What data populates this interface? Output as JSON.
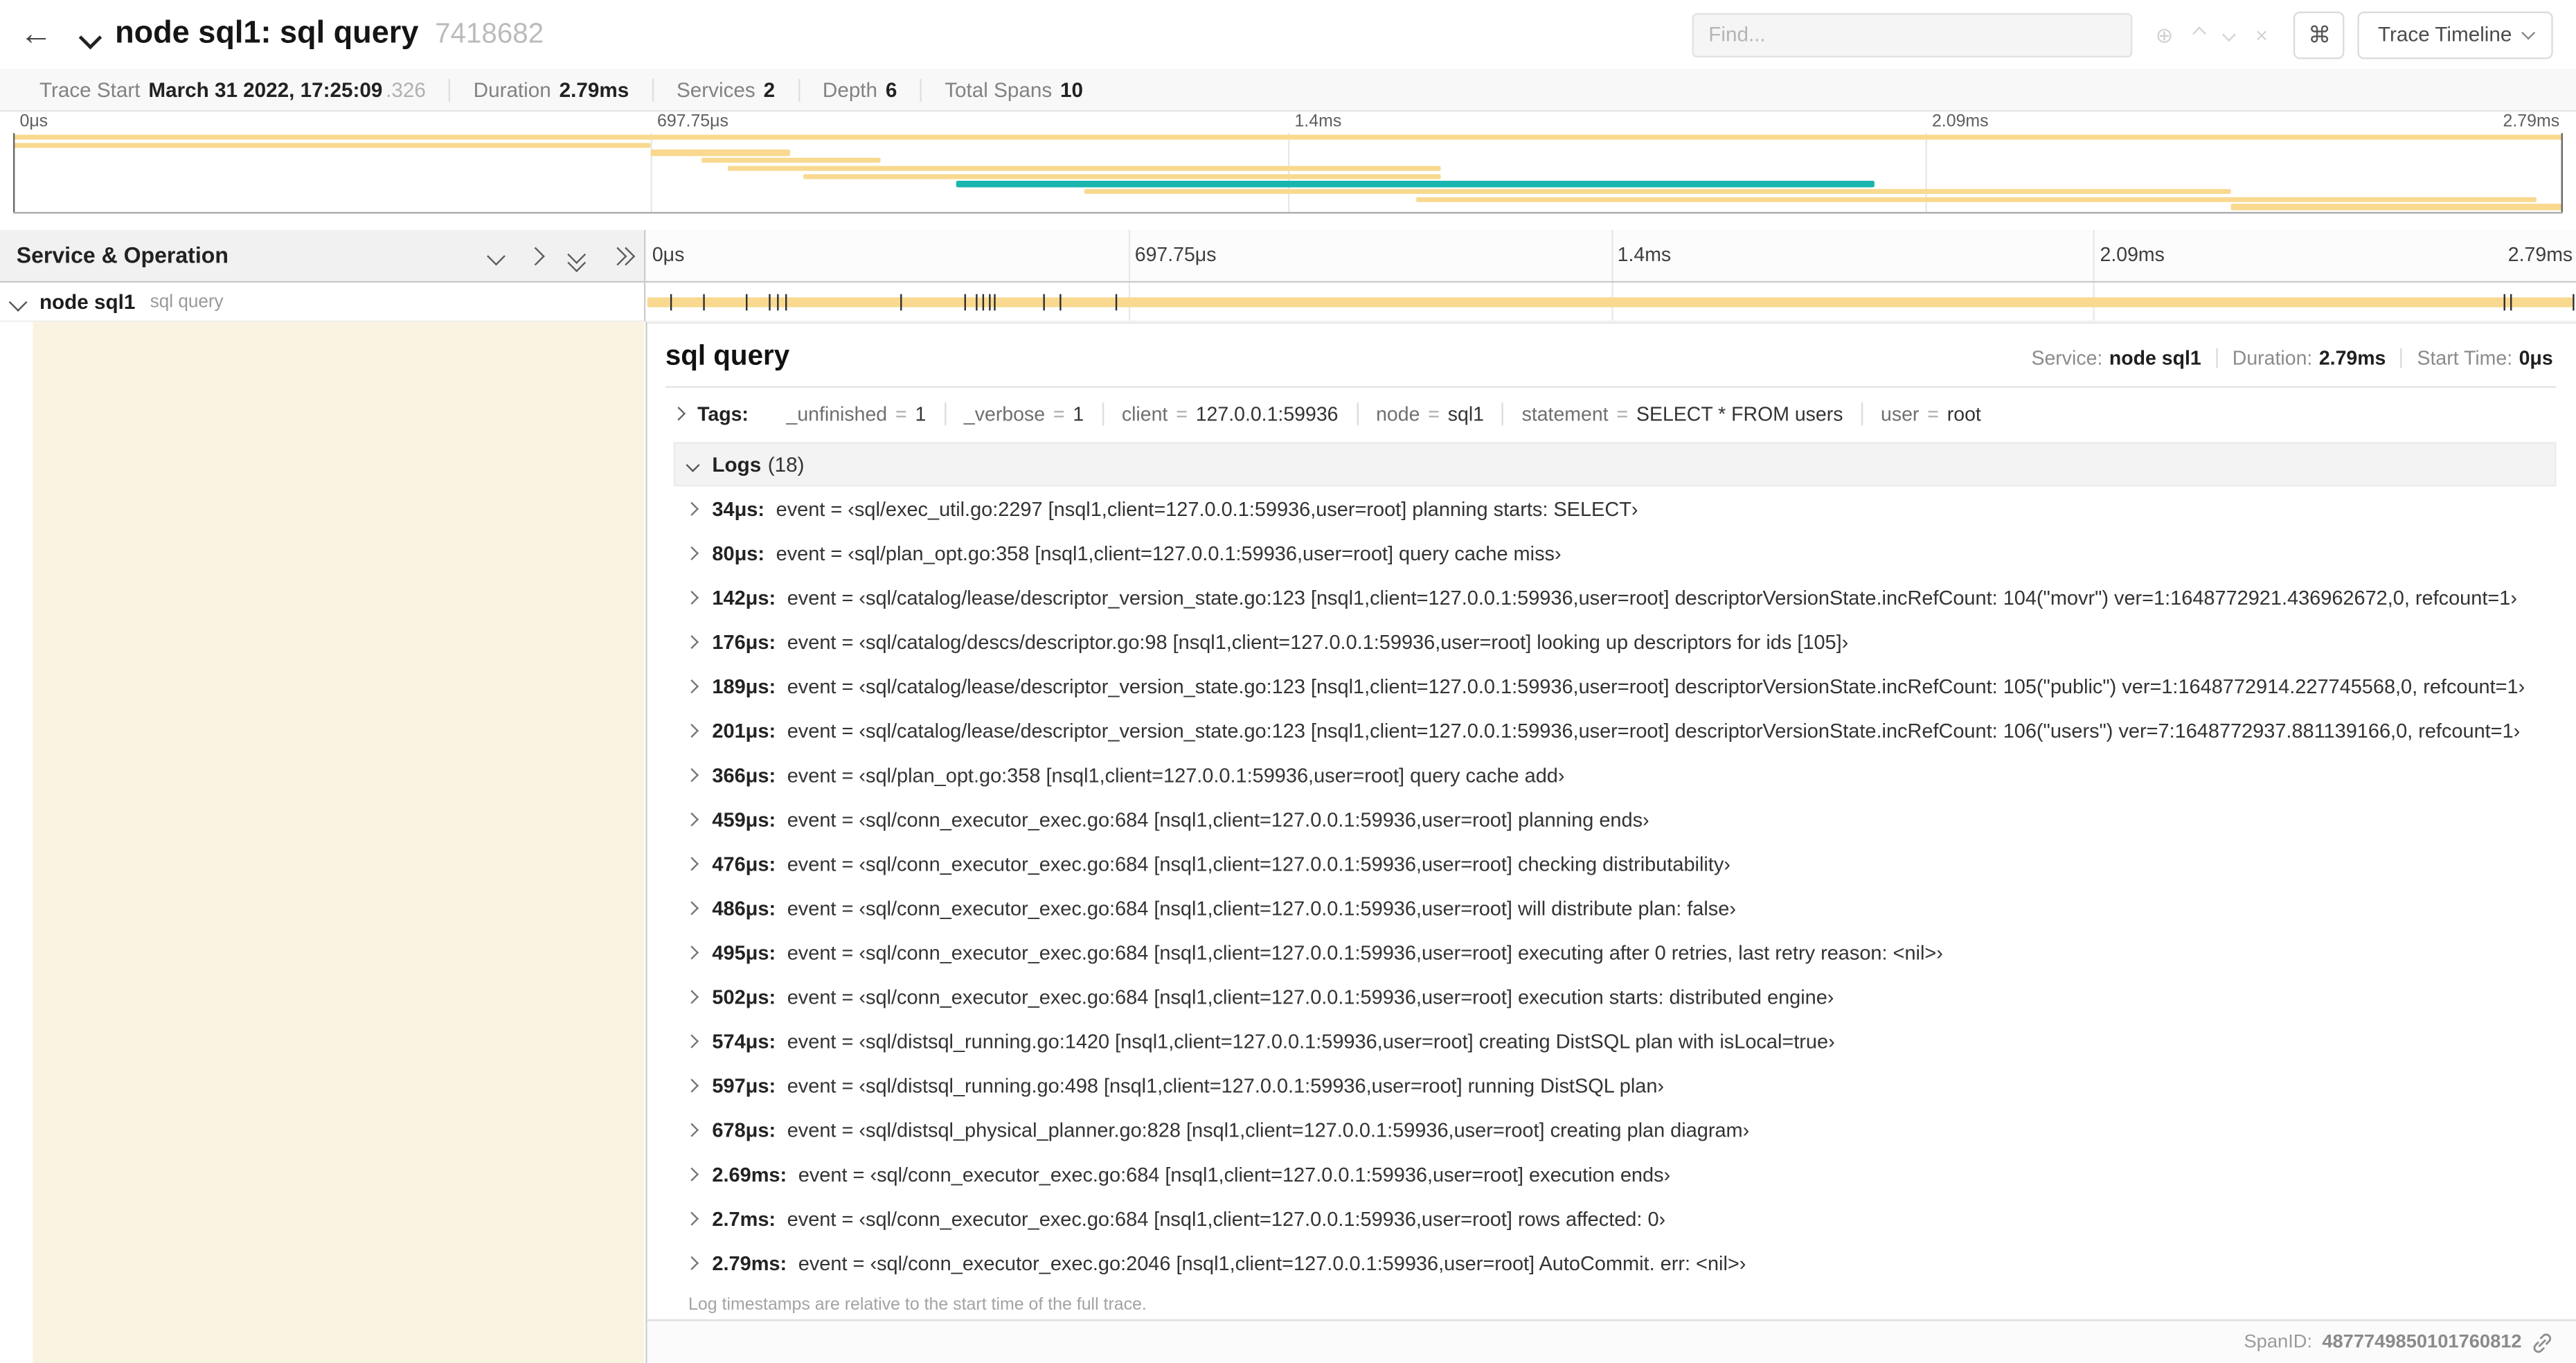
{
  "header": {
    "back_label": "←",
    "title": "node sql1: sql query",
    "trace_id": "7418682",
    "find_placeholder": "Find...",
    "circle_plus": "⊕",
    "clear_glyph": "×",
    "shortcut_key": "⌘",
    "view_select": "Trace Timeline"
  },
  "summary": {
    "items": [
      {
        "label": "Trace Start",
        "value": "March 31 2022, 17:25:09",
        "suffix": ".326"
      },
      {
        "label": "Duration",
        "value": "2.79ms"
      },
      {
        "label": "Services",
        "value": "2"
      },
      {
        "label": "Depth",
        "value": "6"
      },
      {
        "label": "Total Spans",
        "value": "10"
      }
    ]
  },
  "timeline": {
    "duration_us": 2790,
    "ticks": [
      "0μs",
      "697.75μs",
      "1.4ms",
      "2.09ms",
      "2.79ms"
    ],
    "colors": {
      "span": "#F8D98F",
      "teal": "#19B5AE",
      "indent": "#FBF3E1"
    }
  },
  "minimap": {
    "spans": [
      {
        "start": 0,
        "end": 100,
        "color": "#F8D98F"
      },
      {
        "start": 0,
        "end": 25,
        "color": "#F8D98F"
      },
      {
        "start": 25,
        "end": 30.5,
        "color": "#F8D98F"
      },
      {
        "start": 27,
        "end": 34,
        "color": "#F8D98F"
      },
      {
        "start": 28,
        "end": 56,
        "color": "#F8D98F"
      },
      {
        "start": 31,
        "end": 56,
        "color": "#F8D98F"
      },
      {
        "start": 37,
        "end": 73,
        "color": "#19B5AE"
      },
      {
        "start": 42,
        "end": 87,
        "color": "#F8D98F"
      },
      {
        "start": 55,
        "end": 99,
        "color": "#F8D98F"
      },
      {
        "start": 87,
        "end": 100,
        "color": "#F8D98F"
      }
    ]
  },
  "left_panel": {
    "title": "Service & Operation",
    "row": {
      "service": "node sql1",
      "operation": "sql query"
    }
  },
  "detail": {
    "title": "sql query",
    "service_label": "Service:",
    "service_value": "node sql1",
    "duration_label": "Duration:",
    "duration_value": "2.79ms",
    "start_label": "Start Time:",
    "start_value": "0μs",
    "tags_label": "Tags:",
    "tags": [
      {
        "key": "_unfinished",
        "value": "1"
      },
      {
        "key": "_verbose",
        "value": "1"
      },
      {
        "key": "client",
        "value": "127.0.0.1:59936"
      },
      {
        "key": "node",
        "value": "sql1"
      },
      {
        "key": "statement",
        "value": "SELECT * FROM users"
      },
      {
        "key": "user",
        "value": "root"
      }
    ],
    "logs_label": "Logs",
    "logs_count": "(18)",
    "logs": [
      {
        "time": "34μs:",
        "time_us": 34,
        "text": "event = ‹sql/exec_util.go:2297 [nsql1,client=127.0.0.1:59936,user=root] planning starts: SELECT›"
      },
      {
        "time": "80μs:",
        "time_us": 80,
        "text": "event = ‹sql/plan_opt.go:358 [nsql1,client=127.0.0.1:59936,user=root] query cache miss›"
      },
      {
        "time": "142μs:",
        "time_us": 142,
        "text": "event = ‹sql/catalog/lease/descriptor_version_state.go:123 [nsql1,client=127.0.0.1:59936,user=root] descriptorVersionState.incRefCount: 104(\"movr\") ver=1:1648772921.436962672,0, refcount=1›"
      },
      {
        "time": "176μs:",
        "time_us": 176,
        "text": "event = ‹sql/catalog/descs/descriptor.go:98 [nsql1,client=127.0.0.1:59936,user=root] looking up descriptors for ids [105]›"
      },
      {
        "time": "189μs:",
        "time_us": 189,
        "text": "event = ‹sql/catalog/lease/descriptor_version_state.go:123 [nsql1,client=127.0.0.1:59936,user=root] descriptorVersionState.incRefCount: 105(\"public\") ver=1:1648772914.227745568,0, refcount=1›"
      },
      {
        "time": "201μs:",
        "time_us": 201,
        "text": "event = ‹sql/catalog/lease/descriptor_version_state.go:123 [nsql1,client=127.0.0.1:59936,user=root] descriptorVersionState.incRefCount: 106(\"users\") ver=7:1648772937.881139166,0, refcount=1›"
      },
      {
        "time": "366μs:",
        "time_us": 366,
        "text": "event = ‹sql/plan_opt.go:358 [nsql1,client=127.0.0.1:59936,user=root] query cache add›"
      },
      {
        "time": "459μs:",
        "time_us": 459,
        "text": "event = ‹sql/conn_executor_exec.go:684 [nsql1,client=127.0.0.1:59936,user=root] planning ends›"
      },
      {
        "time": "476μs:",
        "time_us": 476,
        "text": "event = ‹sql/conn_executor_exec.go:684 [nsql1,client=127.0.0.1:59936,user=root] checking distributability›"
      },
      {
        "time": "486μs:",
        "time_us": 486,
        "text": "event = ‹sql/conn_executor_exec.go:684 [nsql1,client=127.0.0.1:59936,user=root] will distribute plan: false›"
      },
      {
        "time": "495μs:",
        "time_us": 495,
        "text": "event = ‹sql/conn_executor_exec.go:684 [nsql1,client=127.0.0.1:59936,user=root] executing after 0 retries, last retry reason: <nil>›"
      },
      {
        "time": "502μs:",
        "time_us": 502,
        "text": "event = ‹sql/conn_executor_exec.go:684 [nsql1,client=127.0.0.1:59936,user=root] execution starts: distributed engine›"
      },
      {
        "time": "574μs:",
        "time_us": 574,
        "text": "event = ‹sql/distsql_running.go:1420 [nsql1,client=127.0.0.1:59936,user=root] creating DistSQL plan with isLocal=true›"
      },
      {
        "time": "597μs:",
        "time_us": 597,
        "text": "event = ‹sql/distsql_running.go:498 [nsql1,client=127.0.0.1:59936,user=root] running DistSQL plan›"
      },
      {
        "time": "678μs:",
        "time_us": 678,
        "text": "event = ‹sql/distsql_physical_planner.go:828 [nsql1,client=127.0.0.1:59936,user=root] creating plan diagram›"
      },
      {
        "time": "2.69ms:",
        "time_us": 2690,
        "text": "event = ‹sql/conn_executor_exec.go:684 [nsql1,client=127.0.0.1:59936,user=root] execution ends›"
      },
      {
        "time": "2.7ms:",
        "time_us": 2700,
        "text": "event = ‹sql/conn_executor_exec.go:684 [nsql1,client=127.0.0.1:59936,user=root] rows affected: 0›"
      },
      {
        "time": "2.79ms:",
        "time_us": 2790,
        "text": "event = ‹sql/conn_executor_exec.go:2046 [nsql1,client=127.0.0.1:59936,user=root] AutoCommit. err: <nil>›"
      }
    ],
    "logs_note": "Log timestamps are relative to the start time of the full trace.",
    "footer": {
      "span_id_label": "SpanID:",
      "span_id": "4877749850101760812"
    }
  }
}
